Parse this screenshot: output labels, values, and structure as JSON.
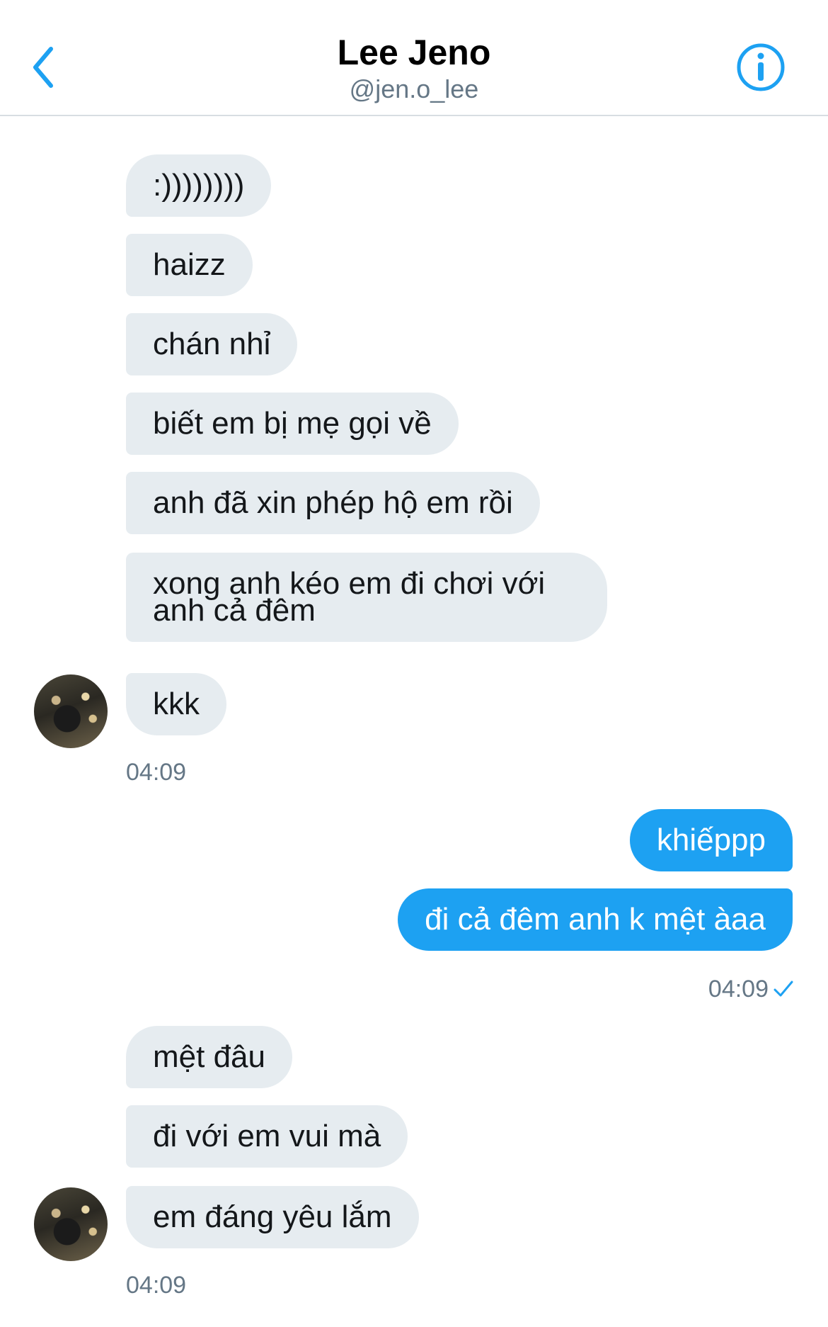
{
  "header": {
    "title": "Lee Jeno",
    "handle": "@jen.o_lee"
  },
  "colors": {
    "accent": "#1da1f2",
    "incoming_bubble": "#e6ecf0",
    "meta_text": "#657786"
  },
  "icons": {
    "back": "chevron-left-icon",
    "info": "info-circle-icon",
    "read": "checkmark-icon"
  },
  "groups": [
    {
      "sender": "them",
      "messages": [
        ":))))))))",
        "haizz",
        "chán nhỉ",
        "biết em bị mẹ gọi về",
        "anh đã xin phép hộ em rồi",
        "xong anh kéo em đi chơi với anh cả đêm",
        "kkk"
      ],
      "time": "04:09"
    },
    {
      "sender": "me",
      "messages": [
        "khiếppp",
        "đi cả đêm anh k mệt àaa"
      ],
      "time": "04:09"
    },
    {
      "sender": "them",
      "messages": [
        "mệt đâu",
        "đi với em vui mà",
        "em đáng yêu lắm"
      ],
      "time": "04:09"
    }
  ]
}
